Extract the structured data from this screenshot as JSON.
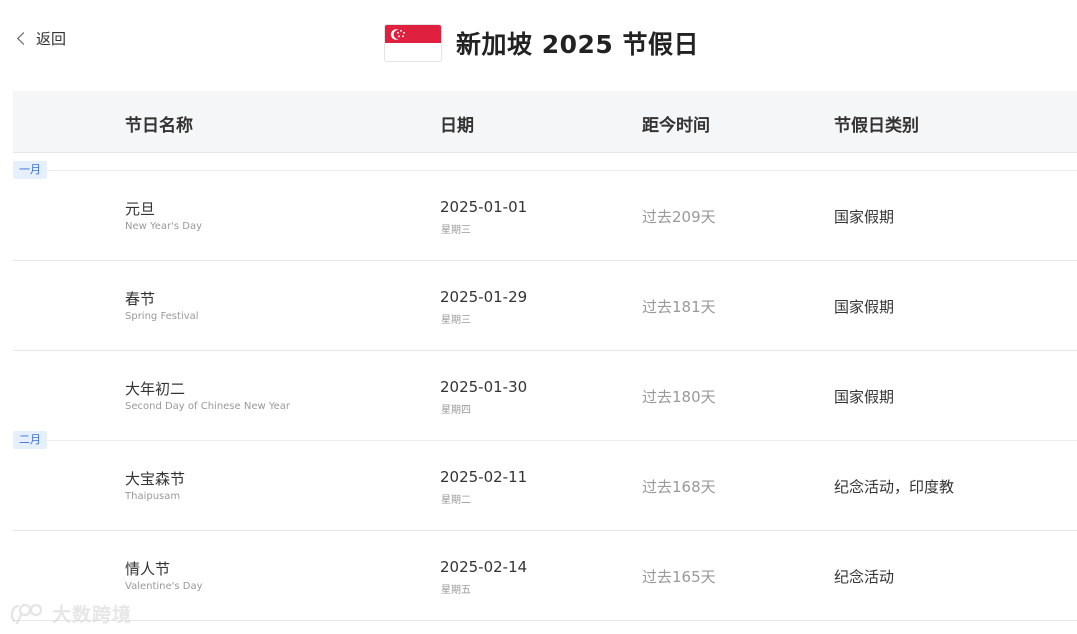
{
  "nav": {
    "back_label": "返回"
  },
  "header": {
    "title": "新加坡 2025 节假日",
    "flag_colors": {
      "top": "#e0203f",
      "bottom": "#ffffff",
      "emblem": "#ffffff"
    }
  },
  "table": {
    "columns": [
      "节日名称",
      "日期",
      "距今时间",
      "节假日类别"
    ],
    "months": [
      "一月",
      "二月"
    ],
    "rows": [
      {
        "name": "元旦",
        "name_en": "New Year's Day",
        "date": "2025-01-01",
        "weekday": "星期三",
        "ago": "过去209天",
        "category": "国家假期"
      },
      {
        "name": "春节",
        "name_en": "Spring Festival",
        "date": "2025-01-29",
        "weekday": "星期三",
        "ago": "过去181天",
        "category": "国家假期"
      },
      {
        "name": "大年初二",
        "name_en": "Second Day of Chinese New Year",
        "date": "2025-01-30",
        "weekday": "星期四",
        "ago": "过去180天",
        "category": "国家假期"
      },
      {
        "name": "大宝森节",
        "name_en": "Thaipusam",
        "date": "2025-02-11",
        "weekday": "星期二",
        "ago": "过去168天",
        "category": "纪念活动，印度教"
      },
      {
        "name": "情人节",
        "name_en": "Valentine's Day",
        "date": "2025-02-14",
        "weekday": "星期五",
        "ago": "过去165天",
        "category": "纪念活动"
      }
    ]
  },
  "watermark": {
    "text": "大数跨境",
    "icon": "logo-icon"
  }
}
